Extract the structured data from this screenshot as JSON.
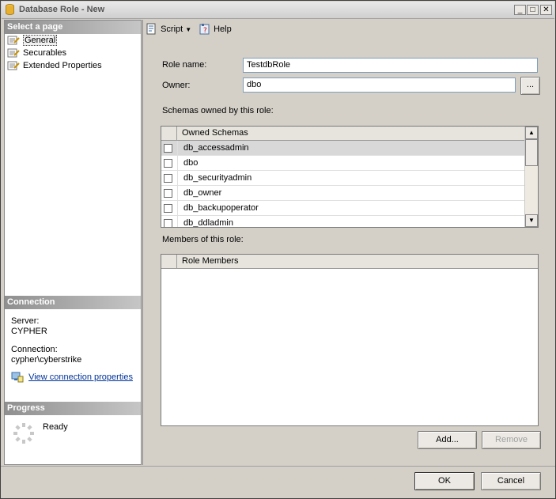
{
  "window": {
    "title": "Database Role - New",
    "buttons": {
      "minimize": "_",
      "maximize": "□",
      "close": "✕"
    }
  },
  "left": {
    "select_page_header": "Select a page",
    "pages": [
      {
        "label": "General",
        "icon": "page-properties-icon",
        "selected": true
      },
      {
        "label": "Securables",
        "icon": "page-properties-icon",
        "selected": false
      },
      {
        "label": "Extended Properties",
        "icon": "page-properties-icon",
        "selected": false
      }
    ],
    "connection_header": "Connection",
    "server_label": "Server:",
    "server_value": "CYPHER",
    "connection_label": "Connection:",
    "connection_value": "cypher\\cyberstrike",
    "view_connection_link": "View connection properties",
    "progress_header": "Progress",
    "progress_status": "Ready"
  },
  "toolbar": {
    "script_label": "Script",
    "help_label": "Help"
  },
  "form": {
    "role_name_label": "Role name:",
    "role_name_value": "TestdbRole",
    "owner_label": "Owner:",
    "owner_value": "dbo",
    "browse_label": "...",
    "schemas_label": "Schemas owned by this role:",
    "schemas_header": "Owned Schemas",
    "schemas": [
      {
        "name": "db_accessadmin",
        "checked": false,
        "selected": true
      },
      {
        "name": "dbo",
        "checked": false,
        "selected": false
      },
      {
        "name": "db_securityadmin",
        "checked": false,
        "selected": false
      },
      {
        "name": "db_owner",
        "checked": false,
        "selected": false
      },
      {
        "name": "db_backupoperator",
        "checked": false,
        "selected": false
      },
      {
        "name": "db_ddladmin",
        "checked": false,
        "selected": false
      }
    ],
    "members_label": "Members of this role:",
    "members_header": "Role Members",
    "add_label": "Add...",
    "remove_label": "Remove"
  },
  "footer": {
    "ok_label": "OK",
    "cancel_label": "Cancel"
  }
}
